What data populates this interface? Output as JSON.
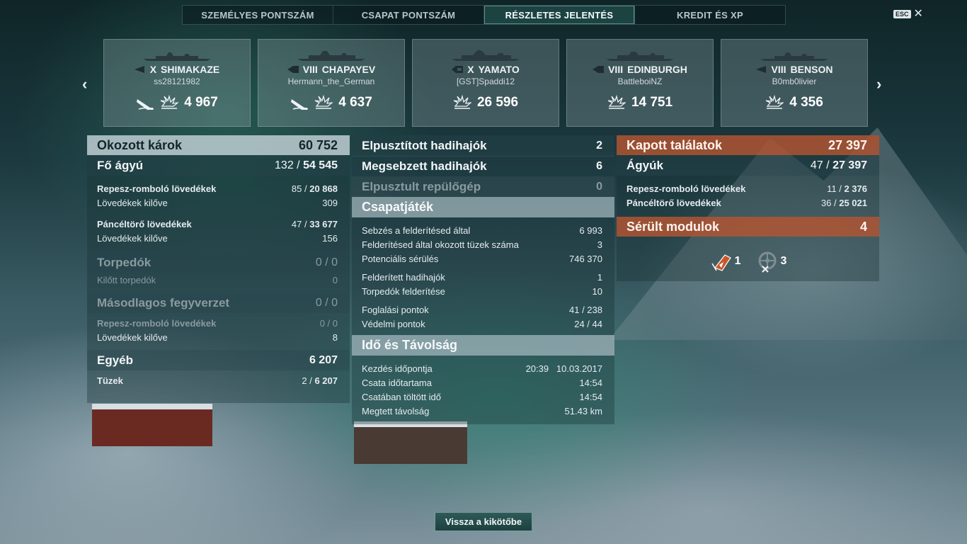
{
  "tabs": [
    {
      "label": "SZEMÉLYES PONTSZÁM",
      "active": false
    },
    {
      "label": "CSAPAT PONTSZÁM",
      "active": false
    },
    {
      "label": "RÉSZLETES JELENTÉS",
      "active": true
    },
    {
      "label": "KREDIT ÉS XP",
      "active": false
    }
  ],
  "esc_label": "ESC",
  "ships": [
    {
      "tier": "X",
      "name": "SHIMAKAZE",
      "player": "ss28121982",
      "damage": "4 967",
      "class": "destroyer",
      "sunk": true
    },
    {
      "tier": "VIII",
      "name": "CHAPAYEV",
      "player": "Hermann_the_German",
      "damage": "4 637",
      "class": "cruiser",
      "sunk": true
    },
    {
      "tier": "X",
      "name": "YAMATO",
      "player": "[GST]Spaddi12",
      "damage": "26 596",
      "class": "battleship",
      "sunk": false
    },
    {
      "tier": "VIII",
      "name": "EDINBURGH",
      "player": "BattleboiNZ",
      "damage": "14 751",
      "class": "cruiser",
      "sunk": false
    },
    {
      "tier": "VIII",
      "name": "BENSON",
      "player": "B0mb0livier",
      "damage": "4 356",
      "class": "destroyer",
      "sunk": false
    }
  ],
  "left": {
    "damage_caused": {
      "label": "Okozott károk",
      "value": "60 752"
    },
    "main_guns": {
      "label": "Fő ágyú",
      "hits": "132",
      "damage": "54 545"
    },
    "he_shells": {
      "label": "Repesz-romboló lövedékek",
      "hits": "85",
      "damage": "20 868"
    },
    "he_fired": {
      "label": "Lövedékek kilőve",
      "value": "309"
    },
    "ap_shells": {
      "label": "Páncéltörő lövedékek",
      "hits": "47",
      "damage": "33 677"
    },
    "ap_fired": {
      "label": "Lövedékek kilőve",
      "value": "156"
    },
    "torpedoes": {
      "label": "Torpedók",
      "value": "0 / 0"
    },
    "torpedoes_fired": {
      "label": "Kilőtt torpedók",
      "value": "0"
    },
    "secondary": {
      "label": "Másodlagos fegyverzet",
      "value": "0 / 0"
    },
    "sec_he": {
      "label": "Repesz-romboló lövedékek",
      "value": "0 / 0"
    },
    "sec_fired": {
      "label": "Lövedékek kilőve",
      "value": "8"
    },
    "other": {
      "label": "Egyéb",
      "value": "6 207"
    },
    "fires": {
      "label": "Tüzek",
      "count": "2",
      "damage": "6 207"
    }
  },
  "middle": {
    "destroyed": {
      "label": "Elpusztított hadihajók",
      "value": "2"
    },
    "damaged": {
      "label": "Megsebzett hadihajók",
      "value": "6"
    },
    "planes": {
      "label": "Elpusztult repülőgép",
      "value": "0"
    },
    "teamplay": {
      "title": "Csapatjáték",
      "rows": [
        {
          "label": "Sebzés a felderítésed által",
          "value": "6 993"
        },
        {
          "label": "Felderítésed által okozott tüzek száma",
          "value": "3"
        },
        {
          "label": "Potenciális sérülés",
          "value": "746 370"
        },
        {
          "label": "Felderített hadihajók",
          "value": "1"
        },
        {
          "label": "Torpedók felderítése",
          "value": "10"
        },
        {
          "label": "Foglalási pontok",
          "value": "41 / 238"
        },
        {
          "label": "Védelmi pontok",
          "value": "24 / 44"
        }
      ]
    },
    "time": {
      "title": "Idő és Távolság",
      "rows": [
        {
          "label": "Kezdés időpontja",
          "value": "20:39   10.03.2017"
        },
        {
          "label": "Csata időtartama",
          "value": "14:54"
        },
        {
          "label": "Csatában töltött idő",
          "value": "14:54"
        },
        {
          "label": "Megtett távolság",
          "value": "51.43 km"
        }
      ]
    }
  },
  "right": {
    "hits_received": {
      "label": "Kapott találatok",
      "value": "27 397"
    },
    "guns": {
      "label": "Ágyúk",
      "hits": "47",
      "damage": "27 397"
    },
    "he": {
      "label": "Repesz-romboló lövedékek",
      "hits": "11",
      "damage": "2 376"
    },
    "ap": {
      "label": "Páncéltörő lövedékek",
      "hits": "36",
      "damage": "25 021"
    },
    "modules": {
      "label": "Sérült modulok",
      "value": "4"
    },
    "module_icons": [
      {
        "icon": "gun-turret-damaged-icon",
        "count": "1"
      },
      {
        "icon": "steering-gear-disabled-icon",
        "count": "3"
      }
    ]
  },
  "back_button": "Vissza a kikötőbe"
}
